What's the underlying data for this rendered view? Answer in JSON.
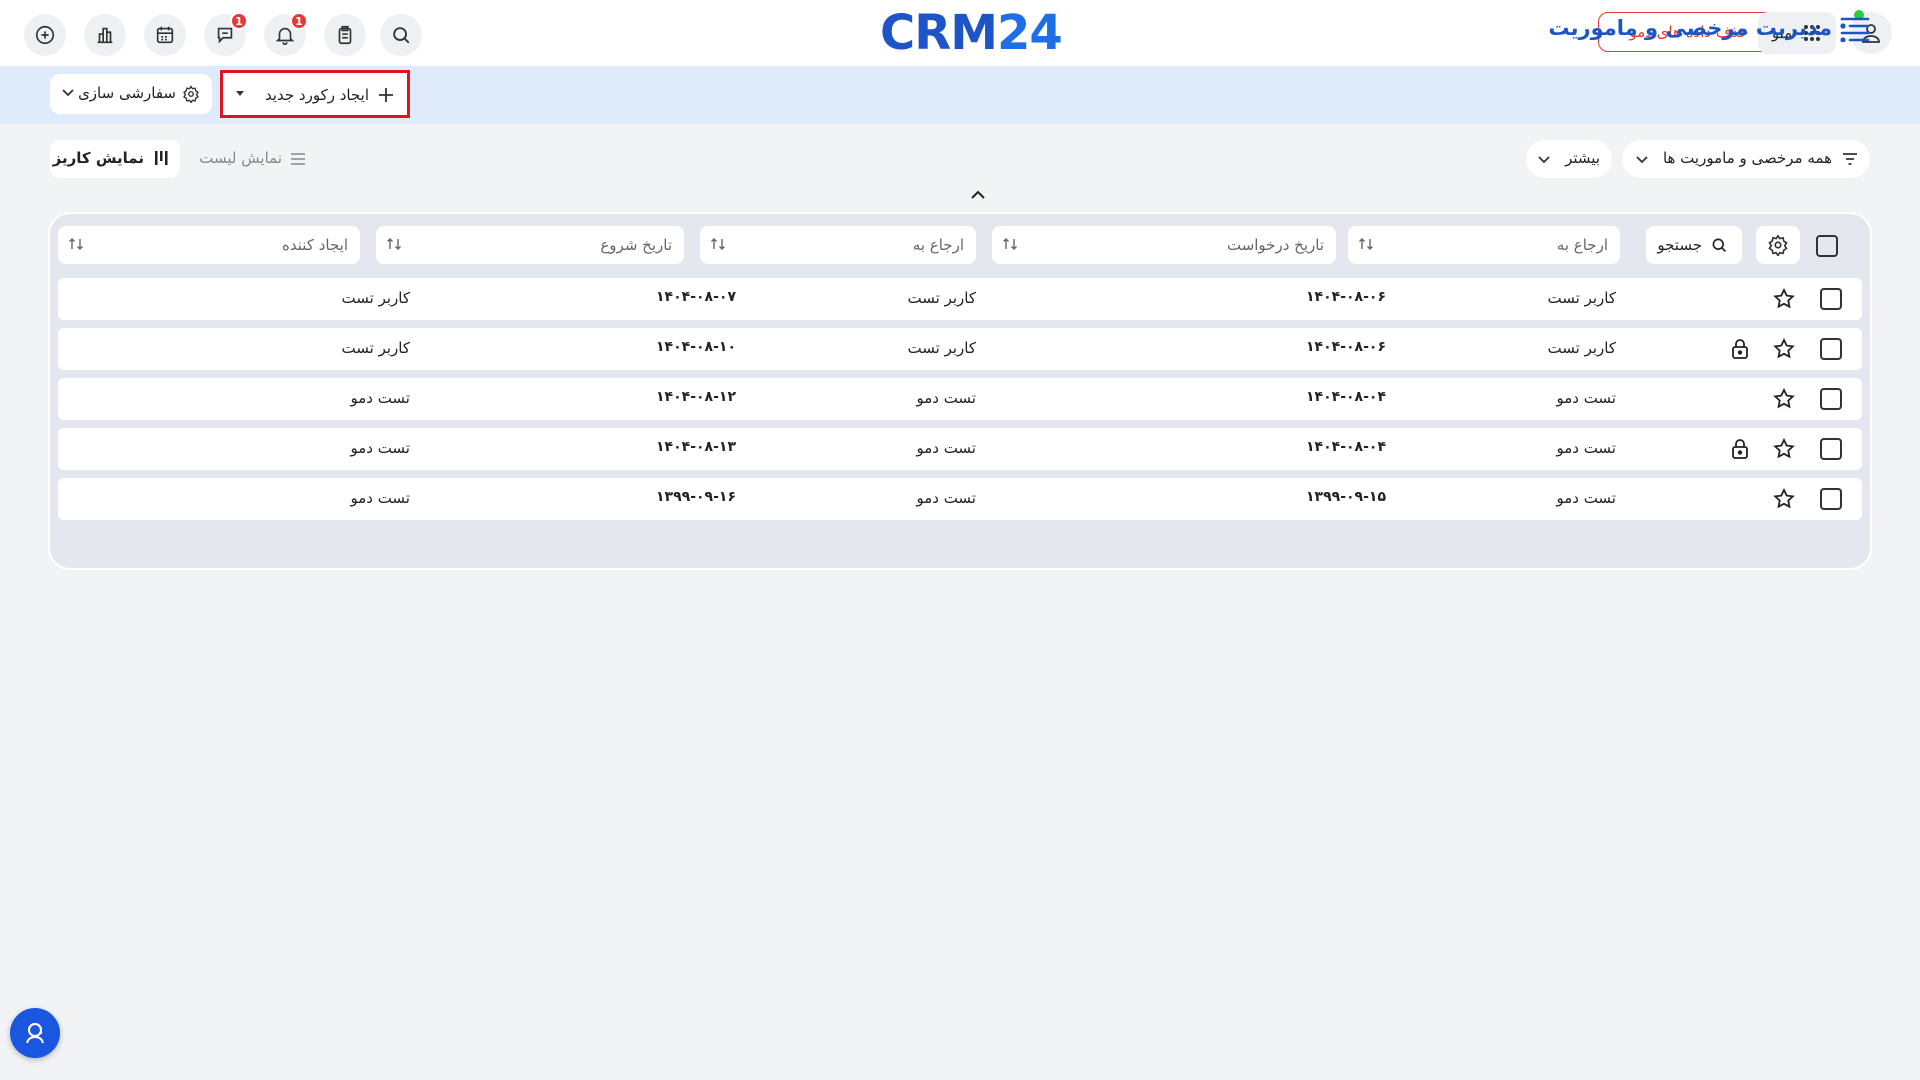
{
  "brand": {
    "logo_crm": "CRM",
    "logo_num": "24",
    "accent": "#1a56c6",
    "danger": "#e53935"
  },
  "topbar": {
    "delete_demo_label": "حذف داده های دمو",
    "menu_label": "منو",
    "chat_badge": "1",
    "bell_badge": "1",
    "icons": [
      "plus-circle-icon",
      "chart-icon",
      "calendar-icon",
      "chat-icon",
      "bell-icon",
      "clipboard-icon",
      "search-icon",
      "grid-icon",
      "user-icon"
    ]
  },
  "subbar": {
    "title": "مدیریت مرخصی و ماموریت",
    "new_record_label": "ایجاد رکورد جدید",
    "customize_label": "سفارشی سازی"
  },
  "filters": {
    "all_label": "همه مرخصی و ماموریت ها",
    "more_label": "بیشتر",
    "list_view_label": "نمایش لیست",
    "kanban_view_label": "نمایش کاریز"
  },
  "table": {
    "search_label": "جستجو",
    "columns": [
      "ارجاع به",
      "تاریخ درخواست",
      "ارجاع به",
      "تاریخ شروع",
      "ایجاد کننده"
    ],
    "rows": [
      {
        "assignee": "کاربر تست",
        "request_date": "۱۴۰۴-۰۸-۰۶",
        "referred_to": "کاربر تست",
        "start_date": "۱۴۰۴-۰۸-۰۷",
        "creator": "کاربر تست",
        "locked": false
      },
      {
        "assignee": "کاربر تست",
        "request_date": "۱۴۰۴-۰۸-۰۶",
        "referred_to": "کاربر تست",
        "start_date": "۱۴۰۴-۰۸-۱۰",
        "creator": "کاربر تست",
        "locked": true
      },
      {
        "assignee": "تست دمو",
        "request_date": "۱۴۰۴-۰۸-۰۴",
        "referred_to": "تست دمو",
        "start_date": "۱۴۰۴-۰۸-۱۲",
        "creator": "تست دمو",
        "locked": false
      },
      {
        "assignee": "تست دمو",
        "request_date": "۱۴۰۴-۰۸-۰۴",
        "referred_to": "تست دمو",
        "start_date": "۱۴۰۴-۰۸-۱۳",
        "creator": "تست دمو",
        "locked": true
      },
      {
        "assignee": "تست دمو",
        "request_date": "۱۳۹۹-۰۹-۱۵",
        "referred_to": "تست دمو",
        "start_date": "۱۳۹۹-۰۹-۱۶",
        "creator": "تست دمو",
        "locked": false
      }
    ]
  }
}
